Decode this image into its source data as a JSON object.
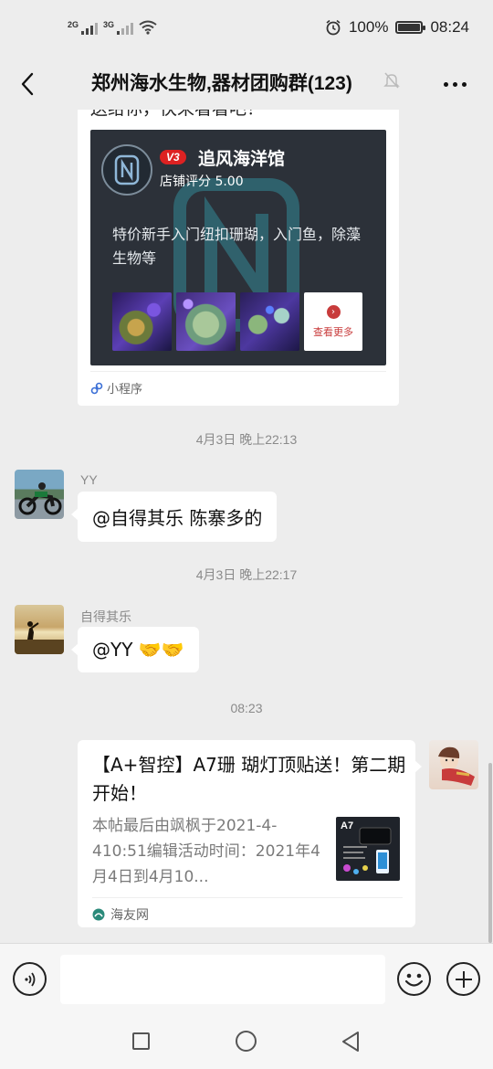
{
  "status_bar": {
    "signal_1": "2G",
    "signal_2": "3G",
    "battery": "100%",
    "time": "08:24"
  },
  "header": {
    "title": "郑州海水生物,器材团购群(123)"
  },
  "messages": {
    "mini_program": {
      "clipped_text": "送给你，快来看看吧！",
      "badge": "V3",
      "shop_name": "追风海洋馆",
      "rating": "店铺评分 5.00",
      "description": "特价新手入门纽扣珊瑚，入门鱼，除藻生物等",
      "see_more": "查看更多",
      "source": "小程序"
    },
    "time_1": "4月3日 晚上22:13",
    "msg_1": {
      "sender": "YY",
      "text": "@自得其乐  陈寨多的"
    },
    "time_2": "4月3日 晚上22:17",
    "msg_2": {
      "sender": "自得其乐",
      "text": "@YY 🤝🤝"
    },
    "time_3": "08:23",
    "link": {
      "title": "【A+智控】A7珊 瑚灯顶贴送！第二期开始！",
      "description": "本帖最后由飒枫于2021-4-410:51编辑活动时间：2021年4月4日到4月10...",
      "thumb_label": "A7",
      "source": "海友网"
    }
  },
  "input": {
    "placeholder": ""
  },
  "colors": {
    "background": "#ededed",
    "bubble": "#ffffff",
    "banner": "#2c3139",
    "badge_red": "#dd2222"
  }
}
